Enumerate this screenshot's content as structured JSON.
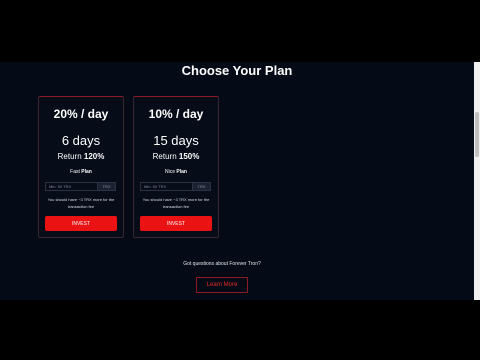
{
  "section": {
    "title": "Choose Your Plan"
  },
  "plans": [
    {
      "rate": "20% / day",
      "days": "6 days",
      "return_label": "Return",
      "return_value": "120%",
      "name_prefix": "Fast",
      "name_suffix": "Plan",
      "input_placeholder": "Min. 50 TRX",
      "currency": "TRX",
      "note": "You should have ~3 TRX more for the transaction fee",
      "button_label": "INVEST"
    },
    {
      "rate": "10% / day",
      "days": "15 days",
      "return_label": "Return",
      "return_value": "150%",
      "name_prefix": "Nice",
      "name_suffix": "Plan",
      "input_placeholder": "Min. 50 TRX",
      "currency": "TRX",
      "note": "You should have ~3 TRX more for the transaction fee",
      "button_label": "INVEST"
    }
  ],
  "faq": {
    "question": "Got questions about Forever Tron?",
    "button_label": "Learn More"
  },
  "colors": {
    "background": "#050b16",
    "accent_red": "#ea1212",
    "card_border": "#8e1a24"
  }
}
